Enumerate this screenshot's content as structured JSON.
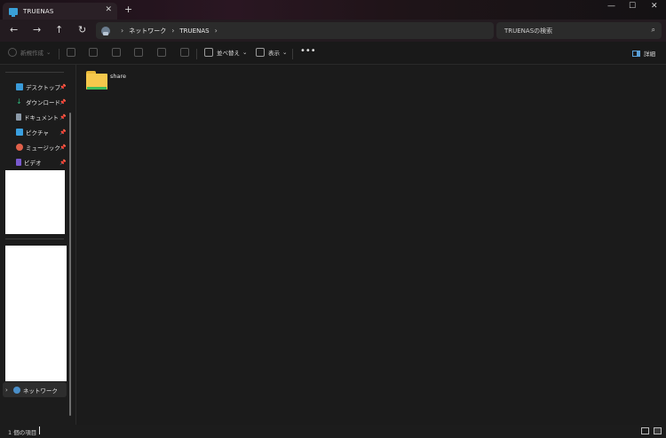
{
  "window": {
    "tab_title": "TRUENAS",
    "tab_close": "✕",
    "new_tab": "+",
    "minimize": "—",
    "maximize": "☐",
    "close": "✕"
  },
  "nav": {
    "back": "←",
    "forward": "→",
    "up": "↑",
    "refresh": "↻",
    "breadcrumb": [
      "ネットワーク",
      "TRUENAS"
    ],
    "separator": "›",
    "search_placeholder": "TRUENASの検索",
    "search_icon": "⌕"
  },
  "commands": {
    "new_label": "新規作成",
    "sort_label": "並べ替え",
    "view_label": "表示",
    "more": "•••",
    "details_label": "詳細",
    "dropdown": "⌄"
  },
  "sidebar": {
    "items": [
      {
        "label": "デスクトップ",
        "icon": "desktop-icon",
        "color": "#3a9bd9"
      },
      {
        "label": "ダウンロード",
        "icon": "download-icon",
        "color": "#2fb37a"
      },
      {
        "label": "ドキュメント",
        "icon": "document-icon",
        "color": "#8c9aa8"
      },
      {
        "label": "ピクチャ",
        "icon": "picture-icon",
        "color": "#3aa0e0"
      },
      {
        "label": "ミュージック",
        "icon": "music-icon",
        "color": "#e0604a"
      },
      {
        "label": "ビデオ",
        "icon": "video-icon",
        "color": "#7a5ad0"
      }
    ],
    "pin": "📌",
    "network_label": "ネットワーク",
    "network_chevron": "›"
  },
  "content": {
    "folders": [
      {
        "name": "share"
      }
    ]
  },
  "status": {
    "item_count": "1 個の項目"
  }
}
